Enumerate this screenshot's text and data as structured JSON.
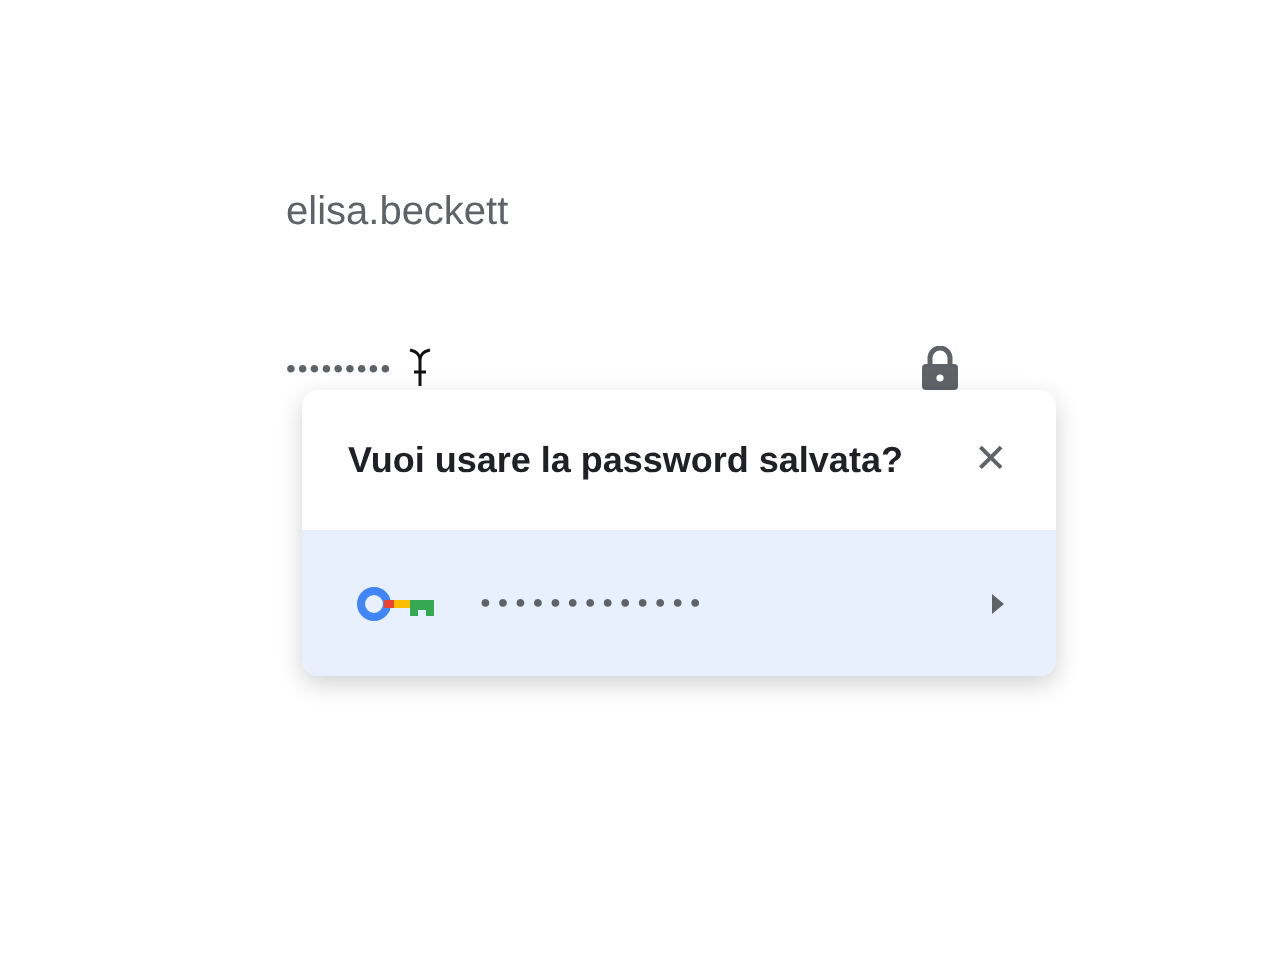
{
  "username_field": {
    "value": "elisa.beckett"
  },
  "password_field": {
    "value": "•••••••••"
  },
  "popup": {
    "title": "Vuoi usare la password salvata?",
    "close": "✕",
    "entries": [
      {
        "password": "●●●●●●●●●●●●●",
        "selected": true
      }
    ]
  }
}
